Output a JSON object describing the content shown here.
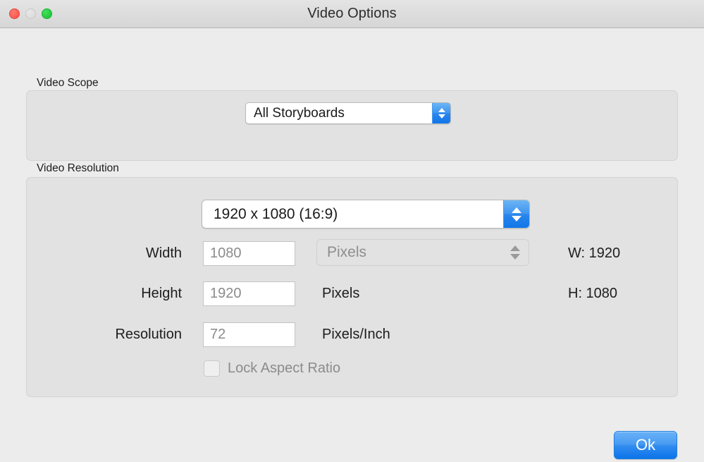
{
  "window": {
    "title": "Video Options",
    "traffic_lights": [
      "close",
      "minimize",
      "zoom"
    ]
  },
  "scope": {
    "group_label": "Video Scope",
    "popup_value": "All Storyboards"
  },
  "resolution": {
    "group_label": "Video Resolution",
    "preset_value": "1920 x 1080 (16:9)",
    "rows": [
      {
        "label": "Width",
        "value": "1080",
        "unit": "Pixels"
      },
      {
        "label": "Height",
        "value": "1920",
        "unit": "Pixels"
      },
      {
        "label": "Resolution",
        "value": "72",
        "unit": "Pixels/Inch"
      }
    ],
    "unit_popup_value": "Pixels",
    "side_labels": {
      "width": "W: 1920",
      "height": "H: 1080"
    },
    "lock_aspect_ratio_label": "Lock Aspect Ratio",
    "lock_aspect_ratio_checked": false
  },
  "footer": {
    "ok_label": "Ok"
  },
  "colors": {
    "window_background": "#ececec",
    "group_background": "#e2e2e2",
    "accent_blue": "#2f8bef",
    "close_red": "#fc5a50",
    "zoom_green": "#22c93d",
    "disabled_text": "#8b8b8b"
  }
}
